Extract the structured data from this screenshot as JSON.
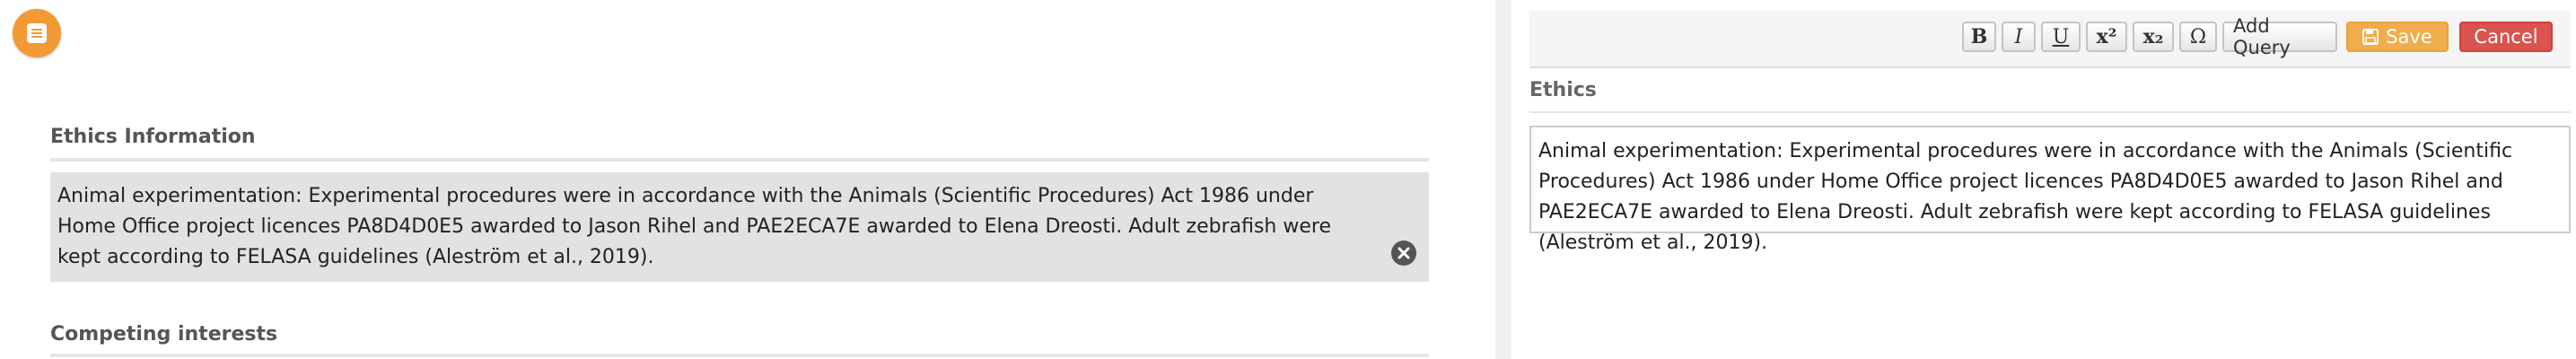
{
  "left_panel": {
    "ethics_heading": "Ethics Information",
    "ethics_text": "Animal experimentation: Experimental procedures were in accordance with the Animals (Scientific Procedures) Act 1986 under Home Office project licences PA8D4D0E5 awarded to Jason Rihel and PAE2ECA7E awarded to Elena Dreosti. Adult zebrafish were kept according to FELASA guidelines (Aleström et al., 2019).",
    "competing_heading": "Competing interests"
  },
  "toolbar": {
    "bold": "B",
    "italic": "I",
    "underline": "U",
    "superscript": "x²",
    "subscript": "x₂",
    "special_char": "Ω",
    "add_query": "Add Query",
    "save": "Save",
    "cancel": "Cancel"
  },
  "right_panel": {
    "heading": "Ethics",
    "editor_text": "Animal experimentation: Experimental procedures were in accordance with the Animals (Scientific Procedures) Act 1986 under Home Office project licences PA8D4D0E5 awarded to Jason Rihel and PAE2ECA7E awarded to Elena Dreosti. Adult zebrafish were kept according to FELASA guidelines (Aleström et al., 2019)."
  },
  "icons": {
    "fab": "chat-icon",
    "clear": "close-circle-icon",
    "save": "floppy-disk-icon"
  },
  "colors": {
    "fab": "#f39a35",
    "save": "#f0ad4e",
    "cancel": "#d9534f",
    "ethics_box": "#e2e2e2"
  }
}
